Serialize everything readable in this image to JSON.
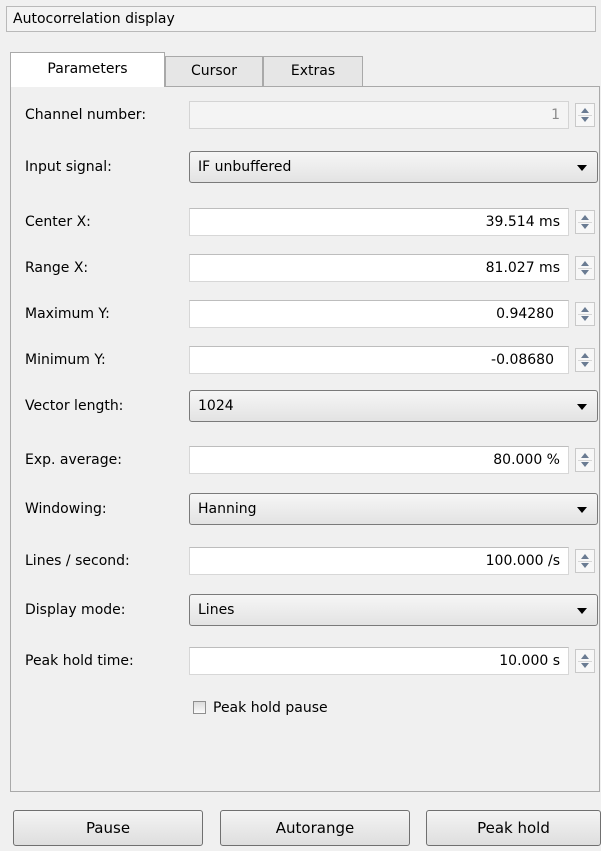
{
  "window": {
    "title": "Autocorrelation display"
  },
  "tabs": [
    {
      "label": "Parameters"
    },
    {
      "label": "Cursor"
    },
    {
      "label": "Extras"
    }
  ],
  "params": {
    "channel_number": {
      "label": "Channel number:",
      "value": "1"
    },
    "input_signal": {
      "label": "Input signal:",
      "value": "IF unbuffered"
    },
    "center_x": {
      "label": "Center X:",
      "value": "39.514 ms"
    },
    "range_x": {
      "label": "Range X:",
      "value": "81.027 ms"
    },
    "maximum_y": {
      "label": "Maximum Y:",
      "value": "0.94280"
    },
    "minimum_y": {
      "label": "Minimum Y:",
      "value": "-0.08680"
    },
    "vector_length": {
      "label": "Vector length:",
      "value": "1024"
    },
    "exp_average": {
      "label": "Exp. average:",
      "value": "80.000 %"
    },
    "windowing": {
      "label": "Windowing:",
      "value": "Hanning"
    },
    "lines_per_second": {
      "label": "Lines / second:",
      "value": "100.000 /s"
    },
    "display_mode": {
      "label": "Display mode:",
      "value": "Lines"
    },
    "peak_hold_time": {
      "label": "Peak hold time:",
      "value": "10.000 s"
    },
    "peak_hold_pause": {
      "label": "Peak hold pause",
      "checked": false
    }
  },
  "buttons": {
    "pause": "Pause",
    "autorange": "Autorange",
    "peak_hold": "Peak hold"
  }
}
